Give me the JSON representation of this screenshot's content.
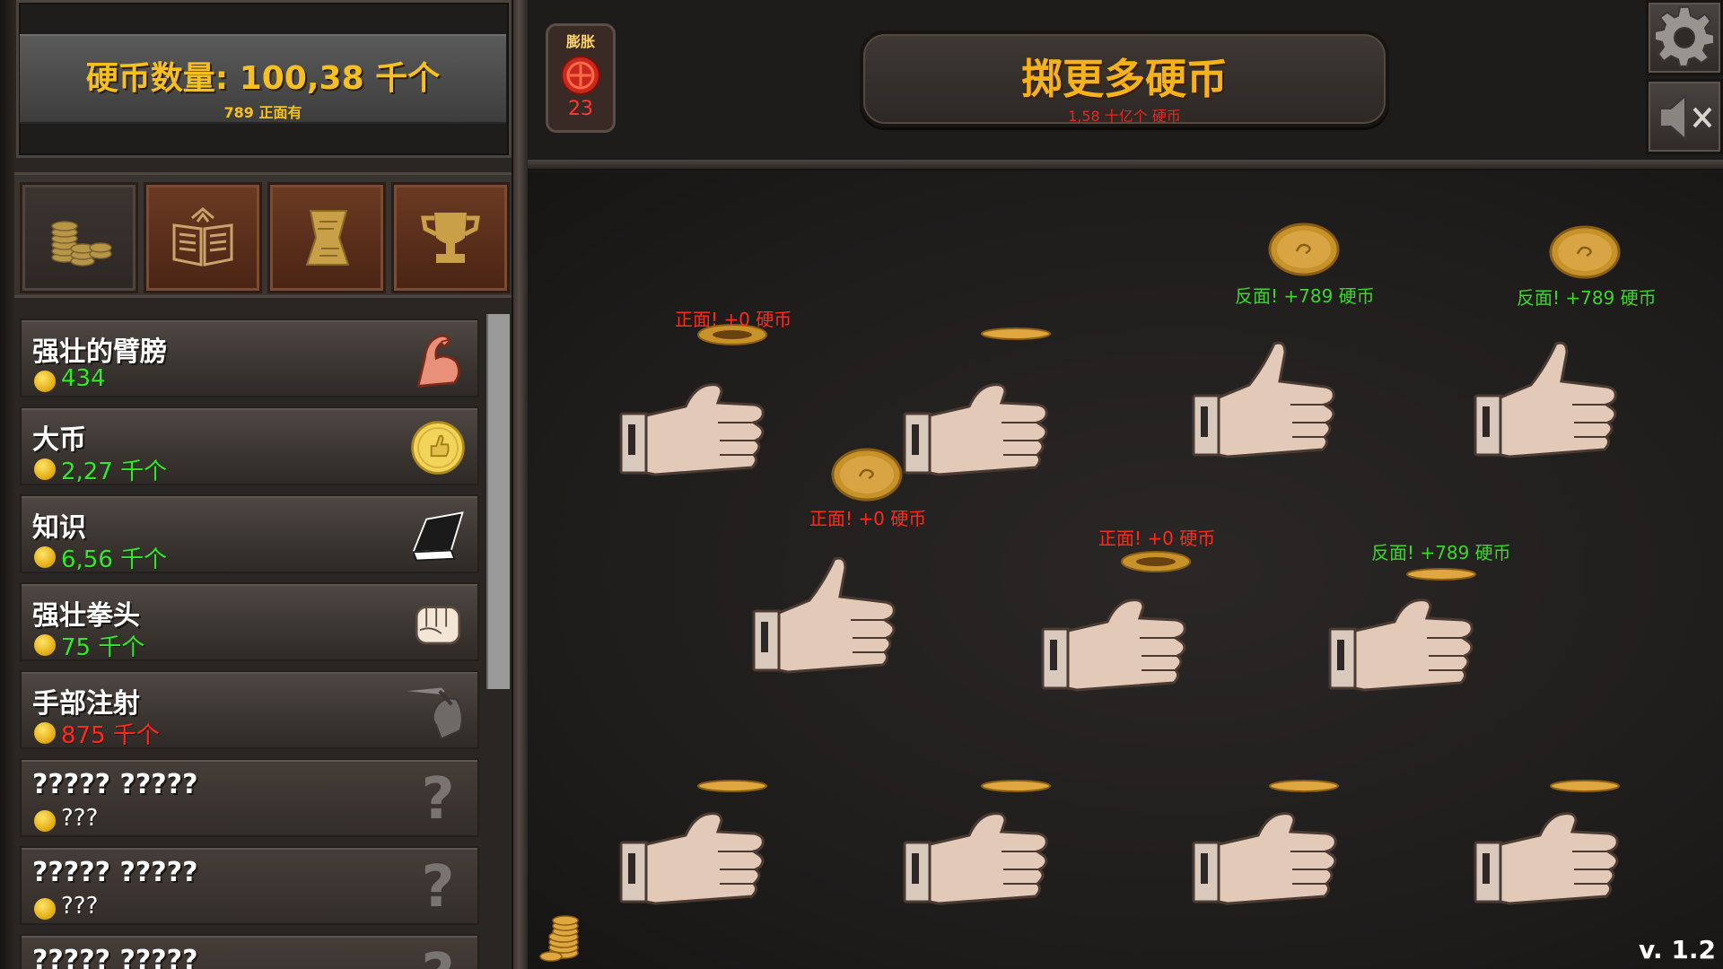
{
  "counter": {
    "main": "硬币数量: 100,38 千个",
    "sub": "789 正面有"
  },
  "tabs": [
    {
      "icon": "coins-icon",
      "active": true
    },
    {
      "icon": "book-icon",
      "active": false
    },
    {
      "icon": "scroll-icon",
      "active": false
    },
    {
      "icon": "trophy-icon",
      "active": false
    }
  ],
  "upgrades": [
    {
      "name": "强壮的臂膀",
      "cost": "434",
      "cost_color": "green",
      "icon": "flexed-arm-icon"
    },
    {
      "name": "大币",
      "cost": "2,27 千个",
      "cost_color": "green",
      "icon": "big-coin-icon"
    },
    {
      "name": "知识",
      "cost": "6,56 千个",
      "cost_color": "green",
      "icon": "book-icon"
    },
    {
      "name": "强壮拳头",
      "cost": "75 千个",
      "cost_color": "green",
      "icon": "fist-icon"
    },
    {
      "name": "手部注射",
      "cost": "875 千个",
      "cost_color": "red",
      "icon": "syringe-hand-icon"
    },
    {
      "name": "????? ?????",
      "cost": "???",
      "cost_color": "white",
      "icon": "question-mark-icon"
    },
    {
      "name": "????? ?????",
      "cost": "???",
      "cost_color": "white",
      "icon": "question-mark-icon"
    },
    {
      "name": "????? ?????",
      "cost": "???",
      "cost_color": "white",
      "icon": "question-mark-icon"
    }
  ],
  "inflation": {
    "label": "膨胀",
    "count": "23",
    "icon": "red-coin-icon"
  },
  "flip_button": {
    "title": "掷更多硬币",
    "sub": "1,58 十亿个 硬币"
  },
  "settings_icon": "gear-icon",
  "sound_icon": "speaker-muted-icon",
  "flip_results": [
    {
      "text": "正面! +0 硬币",
      "color": "red"
    },
    {
      "text": "正面! +0 硬币",
      "color": "red"
    },
    {
      "text": "反面! +789 硬币",
      "color": "green"
    },
    {
      "text": "反面! +789 硬币",
      "color": "green"
    },
    {
      "text": "正面! +0 硬币",
      "color": "red"
    },
    {
      "text": "反面! +789 硬币",
      "color": "green"
    }
  ],
  "colors": {
    "gold": "#f6c01e",
    "green": "#34e82a",
    "red": "#ff2a20",
    "button_orange": "#f6b21a"
  },
  "version": "v. 1.2"
}
